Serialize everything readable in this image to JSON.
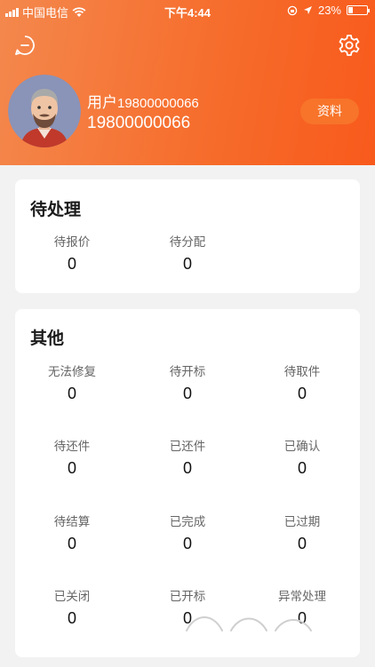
{
  "status_bar": {
    "carrier": "中国电信",
    "time": "下午4:44",
    "battery": "23%",
    "battery_level": 0.23
  },
  "header": {
    "user_label": "用户",
    "user_phone_small": "19800000066",
    "phone": "19800000066",
    "profile_button": "资料"
  },
  "pending": {
    "title": "待处理",
    "items": [
      {
        "label": "待报价",
        "value": "0"
      },
      {
        "label": "待分配",
        "value": "0"
      }
    ]
  },
  "other": {
    "title": "其他",
    "items": [
      {
        "label": "无法修复",
        "value": "0"
      },
      {
        "label": "待开标",
        "value": "0"
      },
      {
        "label": "待取件",
        "value": "0"
      },
      {
        "label": "待还件",
        "value": "0"
      },
      {
        "label": "已还件",
        "value": "0"
      },
      {
        "label": "已确认",
        "value": "0"
      },
      {
        "label": "待结算",
        "value": "0"
      },
      {
        "label": "已完成",
        "value": "0"
      },
      {
        "label": "已过期",
        "value": "0"
      },
      {
        "label": "已关闭",
        "value": "0"
      },
      {
        "label": "已开标",
        "value": "0"
      },
      {
        "label": "异常处理",
        "value": "0"
      }
    ]
  },
  "colors": {
    "accent": "#f66b2a",
    "header_start": "#f4884d",
    "header_end": "#f85a1c"
  }
}
